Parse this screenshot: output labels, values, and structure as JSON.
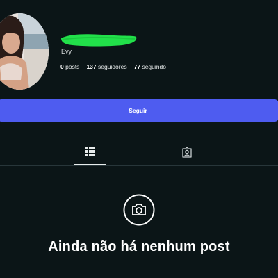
{
  "profile": {
    "username": "Evy",
    "stats": {
      "posts_count": "0",
      "posts_label": "posts",
      "followers_count": "137",
      "followers_label": "seguidores",
      "following_count": "77",
      "following_label": "seguindo"
    },
    "follow_label": "Seguir"
  },
  "tabs": [
    {
      "icon": "grid-icon",
      "active": true
    },
    {
      "icon": "tagged-icon",
      "active": false
    }
  ],
  "empty_state": {
    "icon": "camera-icon",
    "text": "Ainda não há nenhum post"
  },
  "colors": {
    "background": "#0b1517",
    "accent": "#4e5cf0",
    "redaction": "#22e04a"
  }
}
